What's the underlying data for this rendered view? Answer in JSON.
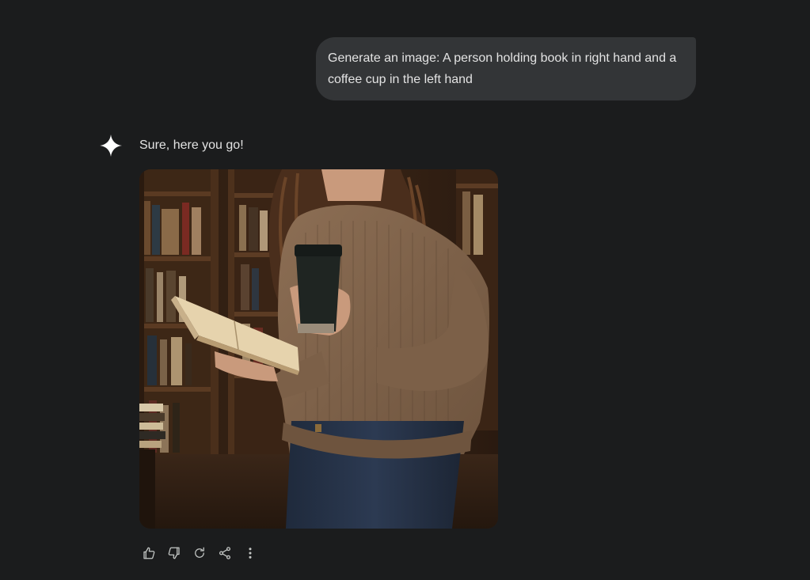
{
  "conversation": {
    "user_message": "Generate an image: A person holding book in right hand and a coffee cup in the left hand",
    "assistant_reply": "Sure, here you go!",
    "assistant_icon": "sparkle-icon",
    "generated_image": {
      "description_icon": "generated-image",
      "palette": {
        "background": "#2b1d13",
        "shelf": "#5a3a22",
        "sweater": "#8a6c52",
        "jeans": "#263247",
        "cup": "#1f2522",
        "book_pages": "#e6d3ad",
        "hair": "#4a2e1c",
        "skin": "#c99a7c"
      }
    }
  },
  "actions": [
    {
      "name": "thumbs-up-icon",
      "label": "Good response"
    },
    {
      "name": "thumbs-down-icon",
      "label": "Bad response"
    },
    {
      "name": "redo-icon",
      "label": "Redo"
    },
    {
      "name": "share-icon",
      "label": "Share"
    },
    {
      "name": "more-icon",
      "label": "More"
    }
  ],
  "colors": {
    "page_background": "#1b1c1d",
    "bubble_background": "#333537",
    "text": "#e3e3e3",
    "icon": "#c4c7c5"
  }
}
